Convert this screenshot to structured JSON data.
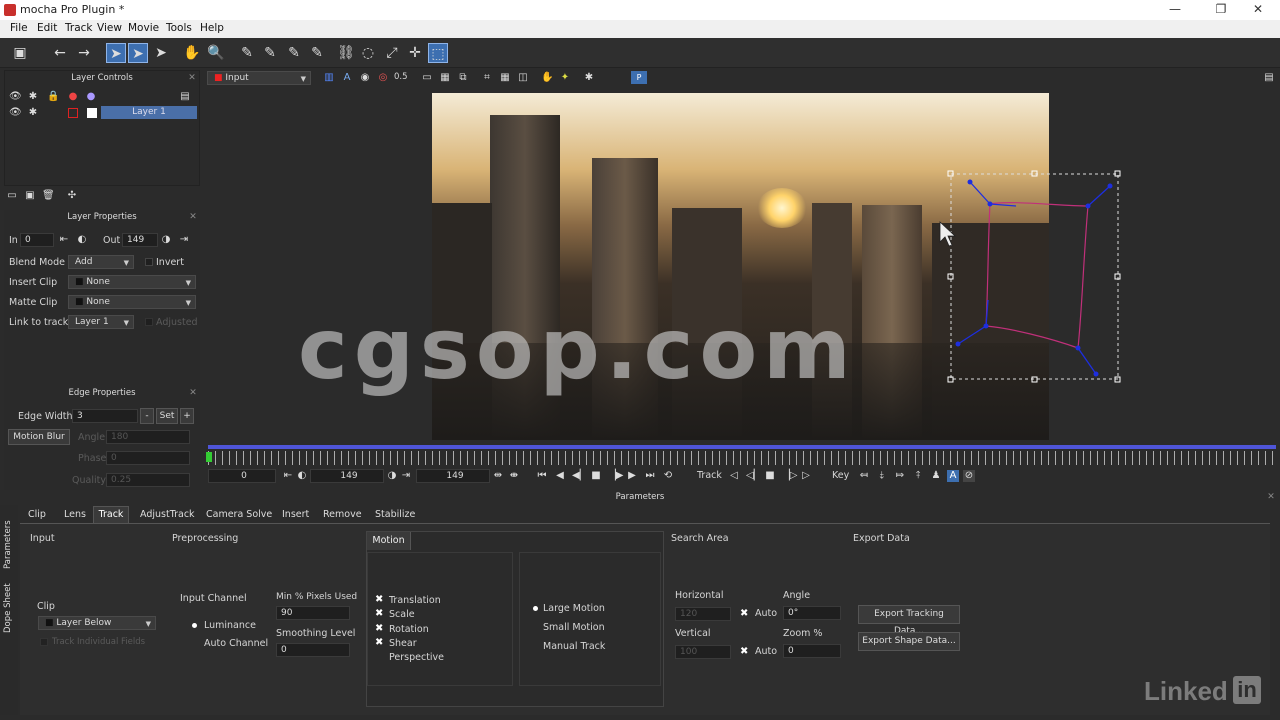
{
  "window": {
    "title": "mocha Pro Plugin *",
    "minimize": "—",
    "restore": "❐",
    "close": "✕"
  },
  "menu": [
    "File",
    "Edit",
    "Track",
    "View",
    "Movie",
    "Tools",
    "Help"
  ],
  "layer_controls": {
    "title": "Layer Controls",
    "layer_name": "Layer 1"
  },
  "layer_properties": {
    "title": "Layer Properties",
    "in_label": "In",
    "in_value": "0",
    "out_label": "Out",
    "out_value": "149",
    "blend_mode_label": "Blend Mode",
    "blend_mode_value": "Add",
    "invert_label": "Invert",
    "insert_clip_label": "Insert Clip",
    "insert_clip_value": "None",
    "matte_clip_label": "Matte Clip",
    "matte_clip_value": "None",
    "link_to_track_label": "Link to track",
    "link_to_track_value": "Layer 1",
    "adjusted_label": "Adjusted"
  },
  "edge_properties": {
    "title": "Edge Properties",
    "edge_width_label": "Edge Width",
    "edge_width_value": "3",
    "minus": "-",
    "set": "Set",
    "plus": "+",
    "motion_blur_label": "Motion Blur",
    "angle_label": "Angle",
    "angle_value": "180",
    "phase_label": "Phase",
    "phase_value": "0",
    "quality_label": "Quality",
    "quality_value": "0.25"
  },
  "viewer_bar": {
    "clip_select": "Input",
    "zoom_value": "0.5",
    "proxy_label": "P"
  },
  "viewer": {
    "watermark": "cgsop.com"
  },
  "timeline": {
    "frame_start": "0",
    "in_frame": "149",
    "out_frame": "149",
    "track_label": "Track",
    "key_label": "Key"
  },
  "parameters": {
    "title": "Parameters",
    "side_tabs": [
      "Parameters",
      "Dope Sheet"
    ],
    "tabs": [
      "Clip",
      "Lens",
      "Track",
      "AdjustTrack",
      "Camera Solve",
      "Insert",
      "Remove",
      "Stabilize"
    ],
    "active_tab": "Track",
    "input_section": "Input",
    "clip_label": "Clip",
    "clip_value": "Layer Below",
    "track_individual_fields": "Track Individual Fields",
    "preprocessing_section": "Preprocessing",
    "input_channel_label": "Input Channel",
    "luminance": "Luminance",
    "auto_channel": "Auto Channel",
    "min_pixels_label": "Min % Pixels Used",
    "min_pixels_value": "90",
    "smoothing_label": "Smoothing Level",
    "smoothing_value": "0",
    "motion_section": "Motion",
    "motion_options": [
      "Translation",
      "Scale",
      "Rotation",
      "Shear",
      "Perspective"
    ],
    "motion_checked": [
      true,
      true,
      true,
      true,
      false
    ],
    "motion_size": [
      "Large Motion",
      "Small Motion",
      "Manual Track"
    ],
    "search_area_section": "Search Area",
    "horizontal_label": "Horizontal",
    "horizontal_value": "120",
    "vertical_label": "Vertical",
    "vertical_value": "100",
    "auto_label": "Auto",
    "angle_label": "Angle",
    "angle_value": "0°",
    "zoom_label": "Zoom %",
    "zoom_value": "0",
    "export_section": "Export Data",
    "export_tracking": "Export Tracking Data...",
    "export_shape": "Export Shape Data..."
  },
  "branding": {
    "linkedin_text": "Linked",
    "linkedin_in": "in"
  },
  "colors": {
    "accent_blue": "#3d6fb0",
    "timeline_bar": "#4f55d8",
    "spline_blue": "#1d2ee0",
    "spline_magenta": "#c0307a"
  }
}
